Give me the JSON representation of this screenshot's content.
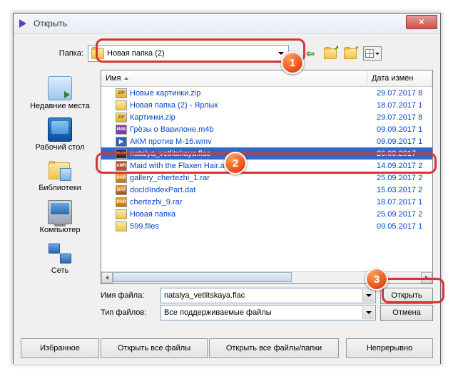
{
  "window": {
    "title": "Открыть"
  },
  "lookin": {
    "label": "Папка:",
    "folder": "Новая папка (2)"
  },
  "places": {
    "recent": "Недавние места",
    "desktop": "Рабочий стол",
    "libraries": "Библиотеки",
    "computer": "Компьютер",
    "network": "Сеть"
  },
  "columns": {
    "name": "Имя",
    "date": "Дата измен"
  },
  "files": [
    {
      "icon": "zip",
      "name": "Новые картинки.zip",
      "date": "29.07.2017 8",
      "sel": false
    },
    {
      "icon": "folder-lnk",
      "name": "Новая папка (2) - Ярлык",
      "date": "18.07.2017 1",
      "sel": false
    },
    {
      "icon": "zip",
      "name": "Картинки.zip",
      "date": "29.07.2017 8",
      "sel": false
    },
    {
      "icon": "m4b",
      "name": "Грёзы о Вавилоне.m4b",
      "date": "09.09.2017 1",
      "sel": false
    },
    {
      "icon": "wmv",
      "name": "АКМ против М-16.wmv",
      "date": "09.09.2017 1",
      "sel": false
    },
    {
      "icon": "flac",
      "name": "natalya_vetlitskaya.flac",
      "date": "26.09.2017",
      "sel": true
    },
    {
      "icon": "amr",
      "name": "Maid with the Flaxen Hair.amr",
      "date": "14.09.2017 2",
      "sel": false
    },
    {
      "icon": "rar",
      "name": "gallery_chertezhi_1.rar",
      "date": "25.09.2017 2",
      "sel": false
    },
    {
      "icon": "dat",
      "name": "docIdIndexPart.dat",
      "date": "15.03.2017 2",
      "sel": false
    },
    {
      "icon": "rar",
      "name": "chertezhi_9.rar",
      "date": "18.07.2017 1",
      "sel": false
    },
    {
      "icon": "folder-s",
      "name": "Новая папка",
      "date": "25.09.2017 2",
      "sel": false
    },
    {
      "icon": "files",
      "name": "599.files",
      "date": "09.05.2017 1",
      "sel": false
    }
  ],
  "fields": {
    "filename_label": "Имя файла:",
    "filename_value": "natalya_vetlitskaya.flac",
    "filetype_label": "Тип файлов:",
    "filetype_value": "Все поддерживаемые файлы"
  },
  "buttons": {
    "open": "Открыть",
    "cancel": "Отмена",
    "favorites": "Избранное",
    "open_all_files": "Открыть все файлы",
    "open_all_folders": "Открыть все файлы/папки",
    "continuous": "Непрерывно"
  },
  "callouts": {
    "1": "1",
    "2": "2",
    "3": "3"
  }
}
